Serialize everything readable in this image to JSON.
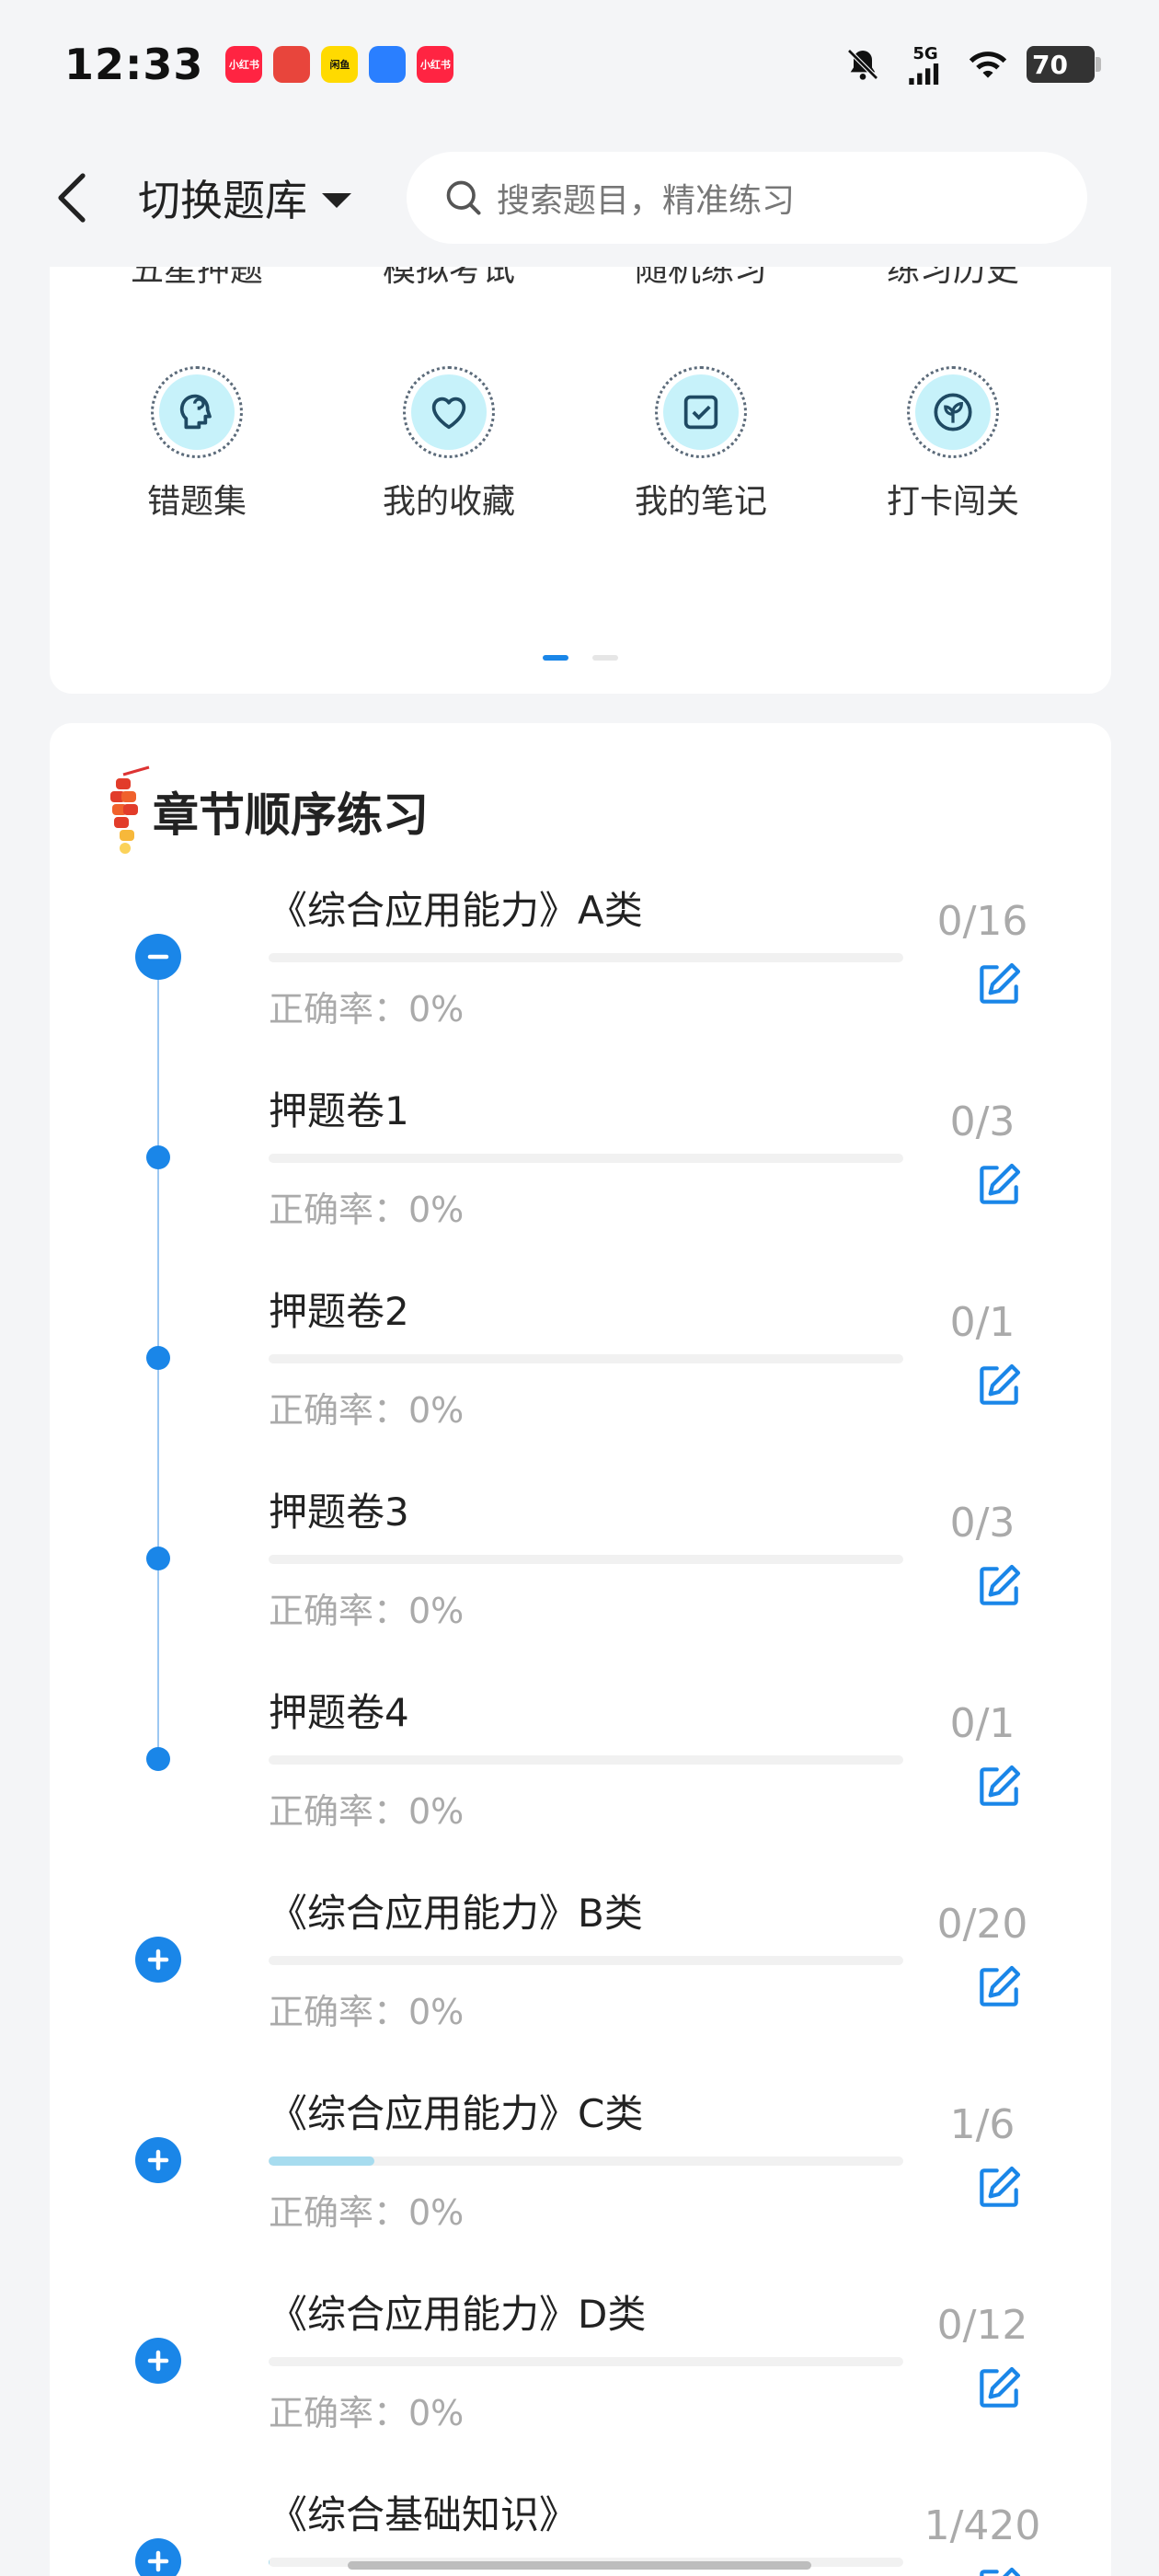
{
  "status_bar": {
    "time": "12:33",
    "apps": [
      {
        "label": "小红书",
        "color": "#ff2442"
      },
      {
        "label": "",
        "color": "#e8453c"
      },
      {
        "label": "闲鱼",
        "color": "#ffda00"
      },
      {
        "label": "",
        "color": "#2a7fff"
      },
      {
        "label": "小红书",
        "color": "#ff2442"
      }
    ],
    "network": "5G",
    "battery": "70"
  },
  "header": {
    "switch_label": "切换题库",
    "search_placeholder": "搜索题目，精准练习"
  },
  "grid": {
    "items": [
      {
        "label": "五星押题",
        "icon": "star-icon"
      },
      {
        "label": "模拟考试",
        "icon": "exam-icon"
      },
      {
        "label": "随机练习",
        "icon": "shuffle-icon"
      },
      {
        "label": "练习历史",
        "icon": "history-icon"
      },
      {
        "label": "错题集",
        "icon": "head-icon"
      },
      {
        "label": "我的收藏",
        "icon": "heart-icon"
      },
      {
        "label": "我的笔记",
        "icon": "note-icon"
      },
      {
        "label": "打卡闯关",
        "icon": "sprout-icon"
      }
    ],
    "page_index": 0,
    "page_count": 2
  },
  "chapters": {
    "title": "章节顺序练习",
    "accuracy_label": "正确率：0%",
    "items": [
      {
        "title": "《综合应用能力》A类",
        "count": "0/16",
        "progress": 0,
        "type": "expanded"
      },
      {
        "title": "押题卷1",
        "count": "0/3",
        "progress": 0,
        "type": "child"
      },
      {
        "title": "押题卷2",
        "count": "0/1",
        "progress": 0,
        "type": "child"
      },
      {
        "title": "押题卷3",
        "count": "0/3",
        "progress": 0,
        "type": "child"
      },
      {
        "title": "押题卷4",
        "count": "0/1",
        "progress": 0,
        "type": "child"
      },
      {
        "title": "《综合应用能力》B类",
        "count": "0/20",
        "progress": 0,
        "type": "collapsed"
      },
      {
        "title": "《综合应用能力》C类",
        "count": "1/6",
        "progress": 0.167,
        "type": "collapsed"
      },
      {
        "title": "《综合应用能力》D类",
        "count": "0/12",
        "progress": 0,
        "type": "collapsed"
      },
      {
        "title": "《综合基础知识》",
        "count": "1/420",
        "progress": 0.002,
        "type": "collapsed"
      }
    ]
  }
}
